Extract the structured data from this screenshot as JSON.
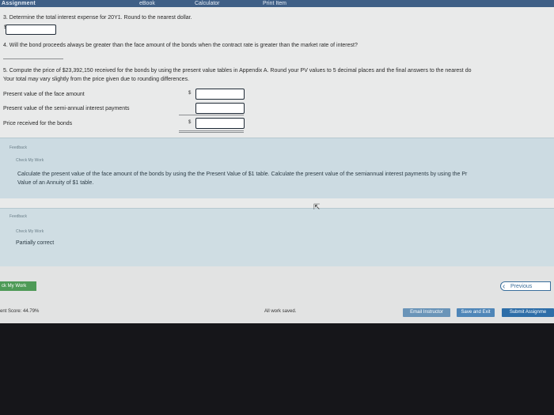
{
  "toolbar": {
    "assignment_label": "Assignment",
    "ebook_label": "eBook",
    "calculator_label": "Calculator",
    "print_label": "Print Item"
  },
  "questions": {
    "q3_text": "3. Determine the total interest expense for 20Y1. Round to the nearest dollar.",
    "q3_dollar": "$",
    "q4_text": "4. Will the bond proceeds always be greater than the face amount of the bonds when the contract rate is greater than the market rate of interest?",
    "q5_text": "5. Compute the price of $23,392,150 received for the bonds by using the present value tables in Appendix A. Round your PV values to 5 decimal places and the final answers to the nearest do",
    "q5_note": "Your total may vary slightly from the price given due to rounding differences.",
    "rows": [
      {
        "label": "Present value of the face amount",
        "dollar": "$"
      },
      {
        "label": "Present value of the semi-annual interest payments",
        "dollar": ""
      },
      {
        "label": "Price received for the bonds",
        "dollar": "$"
      }
    ]
  },
  "feedback1": {
    "header": "Feedback",
    "check_label": "Check My Work",
    "text_line1": "Calculate the present value of the face amount of the bonds by using the the Present Value of $1 table. Calculate the present value of the semiannual interest payments by using the Pr",
    "text_line2": "Value of an Annuity of $1 table."
  },
  "feedback2": {
    "header": "Feedback",
    "check_label": "Check My Work",
    "status": "Partially correct"
  },
  "footer": {
    "check_button": "ck My Work",
    "previous_button": "Previous",
    "score_text": "ent Score: 44.79%",
    "saved_text": "All work saved.",
    "email_button": "Email Instructor",
    "save_exit_button": "Save and Exit",
    "submit_button": "Submit Assignme"
  }
}
